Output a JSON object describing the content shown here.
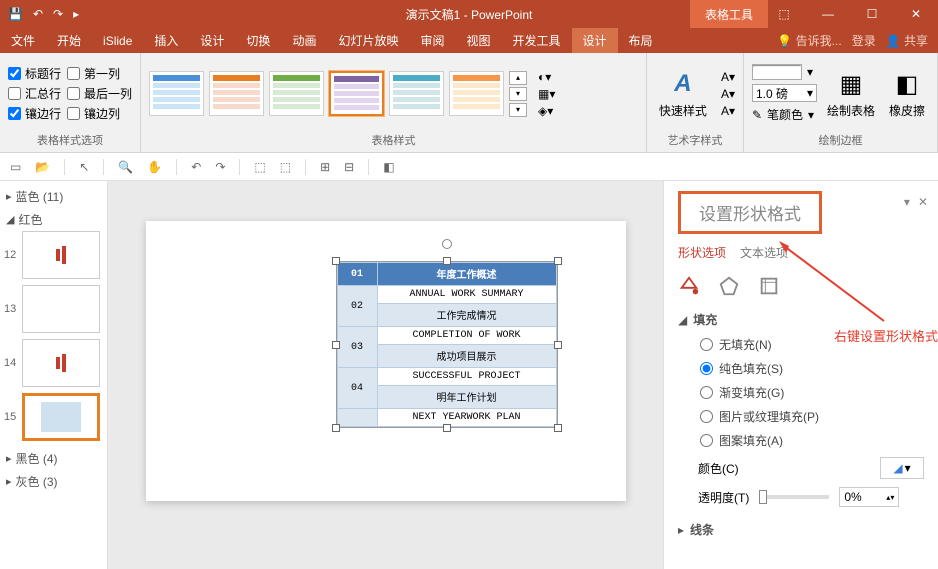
{
  "titlebar": {
    "title": "演示文稿1 - PowerPoint",
    "context_tab": "表格工具"
  },
  "tabs": {
    "file": "文件",
    "home": "开始",
    "islide": "iSlide",
    "insert": "插入",
    "design": "设计",
    "transitions": "切换",
    "animations": "动画",
    "slideshow": "幻灯片放映",
    "review": "审阅",
    "view": "视图",
    "developer": "开发工具",
    "td_design": "设计",
    "td_layout": "布局",
    "tell": "告诉我...",
    "login": "登录",
    "share": "共享"
  },
  "ribbon": {
    "opts": {
      "header_row": "标题行",
      "total_row": "汇总行",
      "banded_rows": "镶边行",
      "first_col": "第一列",
      "last_col": "最后一列",
      "banded_cols": "镶边列",
      "group": "表格样式选项"
    },
    "styles_group": "表格样式",
    "wordart": {
      "label": "艺术字样式",
      "quick": "快速样式"
    },
    "borders": {
      "group": "绘制边框",
      "size": "1.0 磅",
      "pen": "笔颜色",
      "draw": "绘制表格",
      "eraser": "橡皮擦"
    }
  },
  "nav": {
    "blue": "蓝色 (11)",
    "red": "红色",
    "black": "黑色 (4)",
    "gray": "灰色 (3)",
    "s12": "12",
    "s13": "13",
    "s14": "14",
    "s15": "15"
  },
  "table": {
    "h1": "01",
    "h2": "年度工作概述",
    "r1": "ANNUAL WORK SUMMARY",
    "n2": "02",
    "r2": "工作完成情况",
    "r3": "COMPLETION OF WORK",
    "n3": "03",
    "r4": "成功项目展示",
    "r5": "SUCCESSFUL PROJECT",
    "n4": "04",
    "r6": "明年工作计划",
    "r7": "NEXT YEARWORK PLAN"
  },
  "pane": {
    "title": "设置形状格式",
    "tab_shape": "形状选项",
    "tab_text": "文本选项",
    "fill": "填充",
    "nofill": "无填充(N)",
    "solid": "纯色填充(S)",
    "gradient": "渐变填充(G)",
    "picture": "图片或纹理填充(P)",
    "pattern": "图案填充(A)",
    "color": "颜色(C)",
    "trans": "透明度(T)",
    "trans_val": "0%",
    "line": "线条",
    "annotation": "右键设置形状格式"
  }
}
